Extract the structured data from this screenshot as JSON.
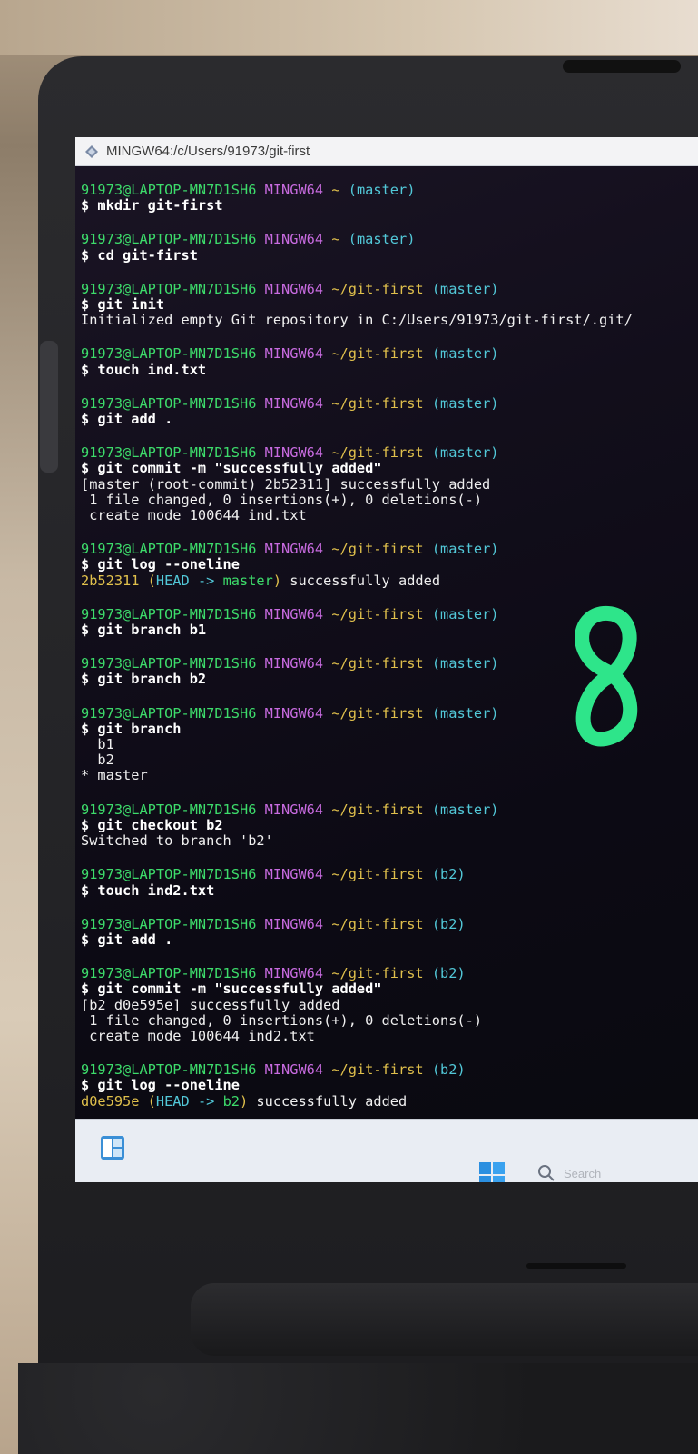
{
  "window": {
    "title": "MINGW64:/c/Users/91973/git-first"
  },
  "terminal": {
    "blocks": [
      {
        "prompt": {
          "user": "91973@LAPTOP-MN7D1SH6",
          "env": "MINGW64",
          "path": "~",
          "branch": "(master)"
        },
        "command": "$ mkdir git-first",
        "output": []
      },
      {
        "prompt": {
          "user": "91973@LAPTOP-MN7D1SH6",
          "env": "MINGW64",
          "path": "~",
          "branch": "(master)"
        },
        "command": "$ cd git-first",
        "output": []
      },
      {
        "prompt": {
          "user": "91973@LAPTOP-MN7D1SH6",
          "env": "MINGW64",
          "path": "~/git-first",
          "branch": "(master)"
        },
        "command": "$ git init",
        "output": [
          "Initialized empty Git repository in C:/Users/91973/git-first/.git/"
        ]
      },
      {
        "prompt": {
          "user": "91973@LAPTOP-MN7D1SH6",
          "env": "MINGW64",
          "path": "~/git-first",
          "branch": "(master)"
        },
        "command": "$ touch ind.txt",
        "output": []
      },
      {
        "prompt": {
          "user": "91973@LAPTOP-MN7D1SH6",
          "env": "MINGW64",
          "path": "~/git-first",
          "branch": "(master)"
        },
        "command": "$ git add .",
        "output": []
      },
      {
        "prompt": {
          "user": "91973@LAPTOP-MN7D1SH6",
          "env": "MINGW64",
          "path": "~/git-first",
          "branch": "(master)"
        },
        "command": "$ git commit -m \"successfully added\"",
        "output": [
          "[master (root-commit) 2b52311] successfully added",
          " 1 file changed, 0 insertions(+), 0 deletions(-)",
          " create mode 100644 ind.txt"
        ]
      },
      {
        "prompt": {
          "user": "91973@LAPTOP-MN7D1SH6",
          "env": "MINGW64",
          "path": "~/git-first",
          "branch": "(master)"
        },
        "command": "$ git log --oneline",
        "log": {
          "hash": "2b52311",
          "open": " (",
          "head": "HEAD ->",
          "ref": " master",
          "close": ")",
          "msg": " successfully added"
        }
      },
      {
        "prompt": {
          "user": "91973@LAPTOP-MN7D1SH6",
          "env": "MINGW64",
          "path": "~/git-first",
          "branch": "(master)"
        },
        "command": "$ git branch b1",
        "output": []
      },
      {
        "prompt": {
          "user": "91973@LAPTOP-MN7D1SH6",
          "env": "MINGW64",
          "path": "~/git-first",
          "branch": "(master)"
        },
        "command": "$ git branch b2",
        "output": []
      },
      {
        "prompt": {
          "user": "91973@LAPTOP-MN7D1SH6",
          "env": "MINGW64",
          "path": "~/git-first",
          "branch": "(master)"
        },
        "command": "$ git branch",
        "output": [
          "  b1",
          "  b2",
          "* master"
        ]
      },
      {
        "prompt": {
          "user": "91973@LAPTOP-MN7D1SH6",
          "env": "MINGW64",
          "path": "~/git-first",
          "branch": "(master)"
        },
        "command": "$ git checkout b2",
        "output": [
          "Switched to branch 'b2'"
        ]
      },
      {
        "prompt": {
          "user": "91973@LAPTOP-MN7D1SH6",
          "env": "MINGW64",
          "path": "~/git-first",
          "branch": "(b2)"
        },
        "command": "$ touch ind2.txt",
        "output": []
      },
      {
        "prompt": {
          "user": "91973@LAPTOP-MN7D1SH6",
          "env": "MINGW64",
          "path": "~/git-first",
          "branch": "(b2)"
        },
        "command": "$ git add .",
        "output": []
      },
      {
        "prompt": {
          "user": "91973@LAPTOP-MN7D1SH6",
          "env": "MINGW64",
          "path": "~/git-first",
          "branch": "(b2)"
        },
        "command": "$ git commit -m \"successfully added\"",
        "output": [
          "[b2 d0e595e] successfully added",
          " 1 file changed, 0 insertions(+), 0 deletions(-)",
          " create mode 100644 ind2.txt"
        ]
      },
      {
        "prompt": {
          "user": "91973@LAPTOP-MN7D1SH6",
          "env": "MINGW64",
          "path": "~/git-first",
          "branch": "(b2)"
        },
        "command": "$ git log --oneline",
        "log": {
          "hash": "d0e595e",
          "open": " (",
          "head": "HEAD ->",
          "ref": " b2",
          "close": ")",
          "msg": " successfully added"
        }
      }
    ]
  },
  "taskbar": {
    "search_label": "Search",
    "icons": [
      "widgets-icon",
      "windows-start-icon",
      "search-icon"
    ]
  },
  "overlay": {
    "handwritten_digit": "8",
    "color": "#2ee58a"
  },
  "colors": {
    "prompt_user": "#3ddc6b",
    "prompt_env": "#c86be0",
    "prompt_path": "#e0c04c",
    "prompt_branch": "#52c8d8"
  }
}
